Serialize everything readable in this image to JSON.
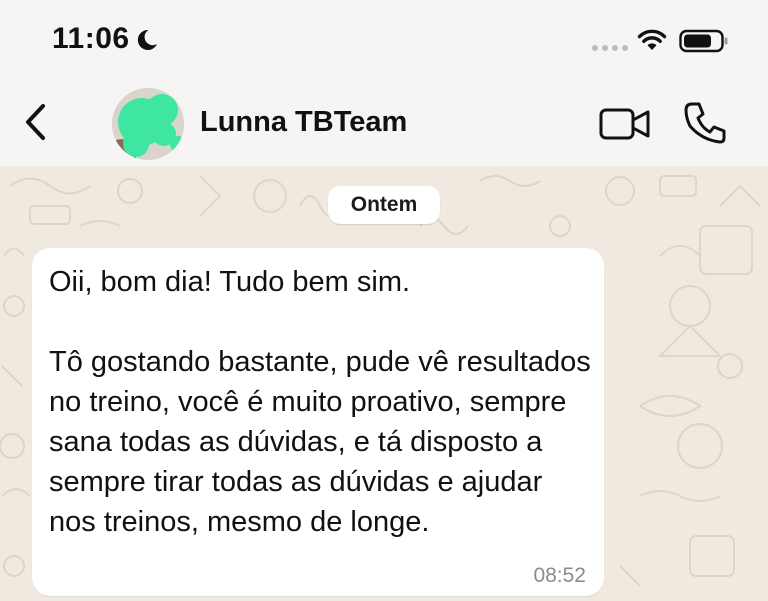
{
  "status_bar": {
    "time": "11:06"
  },
  "header": {
    "contact_name": "Lunna TBTeam"
  },
  "chat": {
    "date_label": "Ontem",
    "messages": [
      {
        "text": "Oii, bom dia! Tudo bem sim.\n\nTô gostando bastante, pude vê resultados no treino, você é muito proativo, sempre sana todas as dúvidas, e tá disposto a sempre tirar todas as dúvidas e ajudar nos treinos, mesmo de longe.",
        "time": "08:52"
      }
    ]
  },
  "icons": {
    "moon": "moon-icon",
    "signal": "signal-icon",
    "wifi": "wifi-icon",
    "battery": "battery-icon",
    "back": "chevron-left-icon",
    "video": "video-camera-icon",
    "phone": "phone-icon"
  },
  "colors": {
    "status_bar_bg": "#f6f5f3",
    "chat_bg": "#efe9df",
    "bubble_bg": "#ffffff",
    "avatar_overlay": "#3ee6a2"
  }
}
